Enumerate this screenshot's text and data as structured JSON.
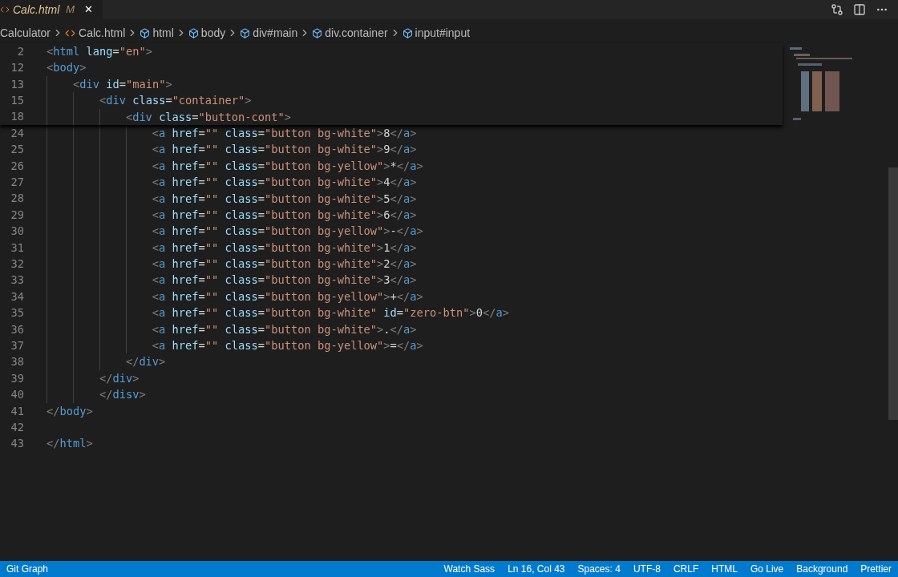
{
  "tab": {
    "title": "Calc.html",
    "badge": "M",
    "close": "✕",
    "modified": true
  },
  "breadcrumb": [
    {
      "kind": "folder",
      "label": "Calculator"
    },
    {
      "kind": "file",
      "label": "Calc.html"
    },
    {
      "kind": "symbol",
      "label": "html"
    },
    {
      "kind": "symbol",
      "label": "body"
    },
    {
      "kind": "symbol",
      "label": "div#main"
    },
    {
      "kind": "symbol",
      "label": "div.container"
    },
    {
      "kind": "symbol",
      "label": "input#input"
    }
  ],
  "sticky_lines": [
    {
      "number": "2",
      "code": "<html lang=\"en\">"
    },
    {
      "number": "12",
      "code": "<body>"
    },
    {
      "number": "13",
      "code": "    <div id=\"main\">"
    },
    {
      "number": "15",
      "code": "        <div class=\"container\">"
    },
    {
      "number": "18",
      "code": "            <div class=\"button-cont\">"
    }
  ],
  "lines": [
    {
      "number": "24",
      "code": "                <a href=\"\" class=\"button bg-white\">8</a>"
    },
    {
      "number": "25",
      "code": "                <a href=\"\" class=\"button bg-white\">9</a>"
    },
    {
      "number": "26",
      "code": "                <a href=\"\" class=\"button bg-yellow\">*</a>"
    },
    {
      "number": "27",
      "code": "                <a href=\"\" class=\"button bg-white\">4</a>"
    },
    {
      "number": "28",
      "code": "                <a href=\"\" class=\"button bg-white\">5</a>"
    },
    {
      "number": "29",
      "code": "                <a href=\"\" class=\"button bg-white\">6</a>"
    },
    {
      "number": "30",
      "code": "                <a href=\"\" class=\"button bg-yellow\">-</a>"
    },
    {
      "number": "31",
      "code": "                <a href=\"\" class=\"button bg-white\">1</a>"
    },
    {
      "number": "32",
      "code": "                <a href=\"\" class=\"button bg-white\">2</a>"
    },
    {
      "number": "33",
      "code": "                <a href=\"\" class=\"button bg-white\">3</a>"
    },
    {
      "number": "34",
      "code": "                <a href=\"\" class=\"button bg-yellow\">+</a>"
    },
    {
      "number": "35",
      "code": "                <a href=\"\" class=\"button bg-white\" id=\"zero-btn\">0</a>"
    },
    {
      "number": "36",
      "code": "                <a href=\"\" class=\"button bg-white\">.</a>"
    },
    {
      "number": "37",
      "code": "                <a href=\"\" class=\"button bg-yellow\">=</a>"
    },
    {
      "number": "38",
      "code": "            </div>"
    },
    {
      "number": "39",
      "code": "        </div>"
    },
    {
      "number": "40",
      "code": "        </disv>"
    },
    {
      "number": "41",
      "code": "</body>"
    },
    {
      "number": "42"
    },
    {
      "number": "43",
      "code": "</html>"
    }
  ],
  "status_bar": {
    "left": [
      "Git Graph"
    ],
    "right": [
      "Watch Sass",
      "Ln 16, Col 43",
      "Spaces: 4",
      "UTF-8",
      "CRLF",
      "HTML",
      "Go Live",
      "Background",
      "Prettier"
    ]
  }
}
